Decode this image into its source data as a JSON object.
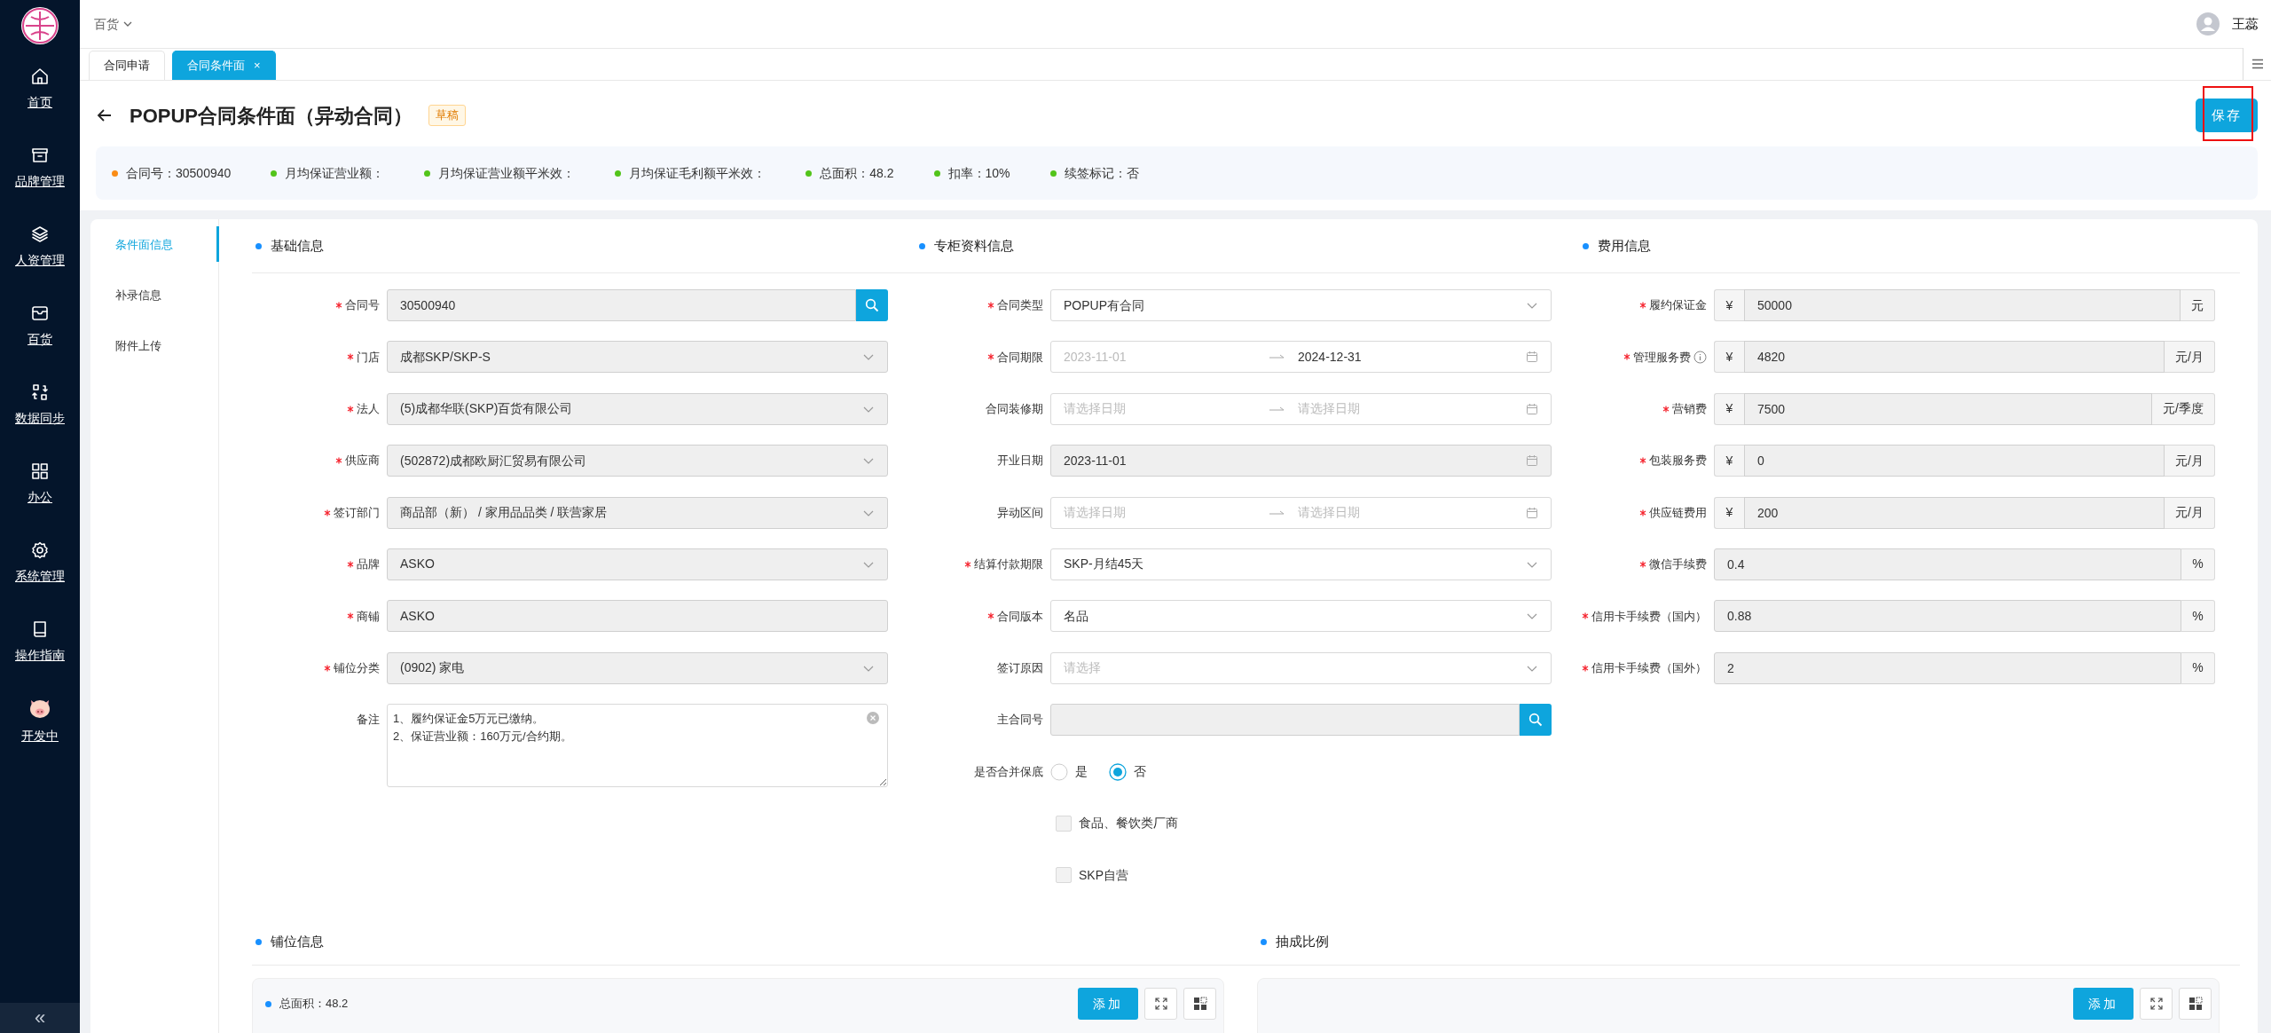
{
  "topbar": {
    "store_menu": "百货",
    "user": "王蕊"
  },
  "sidebar": {
    "items": [
      {
        "label": "首页"
      },
      {
        "label": "品牌管理"
      },
      {
        "label": "人资管理"
      },
      {
        "label": "百货"
      },
      {
        "label": "数据同步"
      },
      {
        "label": "办公"
      },
      {
        "label": "系统管理"
      },
      {
        "label": "操作指南"
      },
      {
        "label": "开发中"
      }
    ],
    "collapse": "«"
  },
  "tabs": [
    {
      "label": "合同申请",
      "selected": false
    },
    {
      "label": "合同条件面",
      "selected": true,
      "close": "×"
    }
  ],
  "page": {
    "title": "POPUP合同条件面（异动合同）",
    "status": "草稿",
    "save_button": "保存",
    "save_highlighted": true
  },
  "summary": [
    {
      "text": "合同号：30500940",
      "color": "#fa8c16"
    },
    {
      "text": "月均保证营业额：",
      "color": "#52c41a"
    },
    {
      "text": "月均保证营业额平米效：",
      "color": "#52c41a"
    },
    {
      "text": "月均保证毛利额平米效：",
      "color": "#52c41a"
    },
    {
      "text": "总面积：48.2",
      "color": "#52c41a"
    },
    {
      "text": "扣率：10%",
      "color": "#52c41a"
    },
    {
      "text": "续签标记：否",
      "color": "#52c41a"
    }
  ],
  "nav": [
    {
      "label": "条件面信息",
      "selected": true
    },
    {
      "label": "补录信息",
      "selected": false
    },
    {
      "label": "附件上传",
      "selected": false
    }
  ],
  "sections": [
    {
      "title": "基础信息",
      "fields": [
        {
          "kind": "search",
          "label": "合同号",
          "required": true,
          "disabled": true,
          "value": "30500940"
        },
        {
          "kind": "select",
          "label": "门店",
          "required": true,
          "disabled": true,
          "value": "成都SKP/SKP-S"
        },
        {
          "kind": "select",
          "label": "法人",
          "required": true,
          "disabled": true,
          "value": "(5)成都华联(SKP)百货有限公司"
        },
        {
          "kind": "select",
          "label": "供应商",
          "required": true,
          "disabled": true,
          "value": "(502872)成都欧厨汇贸易有限公司"
        },
        {
          "kind": "select",
          "label": "签订部门",
          "required": true,
          "disabled": true,
          "value": "商品部（新） / 家用品品类 / 联营家居"
        },
        {
          "kind": "select",
          "label": "品牌",
          "required": true,
          "disabled": true,
          "value": "ASKO"
        },
        {
          "kind": "input",
          "label": "商铺",
          "required": true,
          "disabled": true,
          "value": "ASKO"
        },
        {
          "kind": "select",
          "label": "铺位分类",
          "required": true,
          "disabled": true,
          "value": "(0902) 家电"
        },
        {
          "kind": "textarea",
          "label": "备注",
          "disabled": false,
          "value": "1、履约保证金5万元已缴纳。\n2、保证营业额：160万元/合约期。"
        }
      ]
    },
    {
      "title": "专柜资料信息",
      "fields": [
        {
          "kind": "select",
          "label": "合同类型",
          "required": true,
          "disabled": false,
          "value": "POPUP有合同"
        },
        {
          "kind": "daterange",
          "label": "合同期限",
          "required": true,
          "disabled": false,
          "start": {
            "value": "2023-11-01",
            "disabled": true
          },
          "end": {
            "value": "2024-12-31",
            "disabled": false
          }
        },
        {
          "kind": "daterange",
          "label": "合同装修期",
          "disabled": false,
          "start": {
            "placeholder": "请选择日期"
          },
          "end": {
            "placeholder": "请选择日期"
          }
        },
        {
          "kind": "date",
          "label": "开业日期",
          "disabled": true,
          "value": "2023-11-01"
        },
        {
          "kind": "daterange",
          "label": "异动区间",
          "disabled": false,
          "start": {
            "placeholder": "请选择日期"
          },
          "end": {
            "placeholder": "请选择日期"
          }
        },
        {
          "kind": "select",
          "label": "结算付款期限",
          "required": true,
          "disabled": false,
          "value": "SKP-月结45天"
        },
        {
          "kind": "select",
          "label": "合同版本",
          "required": true,
          "disabled": false,
          "value": "名品"
        },
        {
          "kind": "select",
          "label": "签订原因",
          "disabled": false,
          "placeholder": "请选择"
        },
        {
          "kind": "search",
          "label": "主合同号",
          "disabled": true
        },
        {
          "kind": "radio",
          "label": "是否合并保底",
          "options": [
            {
              "label": "是",
              "selected": false
            },
            {
              "label": "否",
              "selected": true
            }
          ]
        },
        {
          "kind": "checkbox",
          "text": "食品、餐饮类厂商",
          "checked": false,
          "disabled": true
        },
        {
          "kind": "checkbox",
          "text": "SKP自营",
          "checked": false,
          "disabled": true
        }
      ]
    },
    {
      "title": "费用信息",
      "fields": [
        {
          "kind": "input",
          "label": "履约保证金",
          "required": true,
          "disabled": true,
          "prefix": "¥",
          "value": "50000",
          "suffix": "元"
        },
        {
          "kind": "input",
          "label": "管理服务费",
          "required": true,
          "info": true,
          "disabled": true,
          "prefix": "¥",
          "value": "4820",
          "suffix": "元/月"
        },
        {
          "kind": "input",
          "label": "营销费",
          "required": true,
          "disabled": true,
          "prefix": "¥",
          "value": "7500",
          "suffix": "元/季度"
        },
        {
          "kind": "input",
          "label": "包装服务费",
          "required": true,
          "disabled": true,
          "prefix": "¥",
          "value": "0",
          "suffix": "元/月"
        },
        {
          "kind": "input",
          "label": "供应链费用",
          "required": true,
          "disabled": true,
          "prefix": "¥",
          "value": "200",
          "suffix": "元/月"
        },
        {
          "kind": "input",
          "label": "微信手续费",
          "required": true,
          "disabled": true,
          "value": "0.4",
          "suffix": "%"
        },
        {
          "kind": "input",
          "label": "信用卡手续费（国内）",
          "required": true,
          "disabled": true,
          "value": "0.88",
          "suffix": "%"
        },
        {
          "kind": "input",
          "label": "信用卡手续费（国外）",
          "required": true,
          "disabled": true,
          "value": "2",
          "suffix": "%"
        }
      ]
    }
  ],
  "bottom_sections": [
    {
      "title": "铺位信息",
      "summary": "总面积：48.2",
      "add_button": "添加"
    },
    {
      "title": "抽成比例",
      "add_button": "添加"
    }
  ]
}
